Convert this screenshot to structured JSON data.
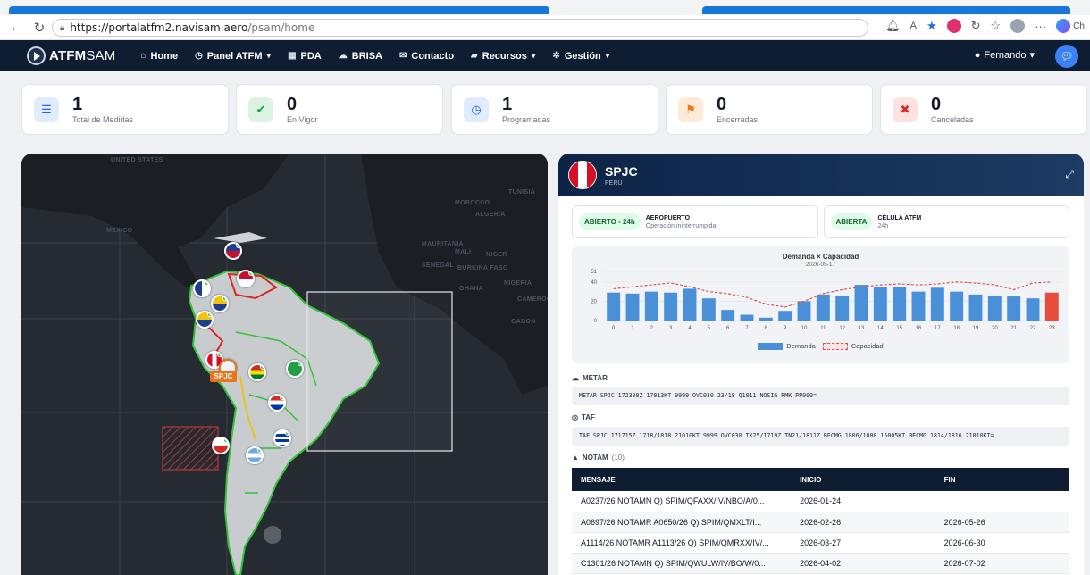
{
  "browser": {
    "url_host": "https://portalatfm2.navisam.aero",
    "url_path": "/psam/home",
    "right_label": "Ch"
  },
  "app": {
    "brand_bold": "ATFM",
    "brand_light": "SAM",
    "menu": [
      {
        "label": "Home",
        "icon": "home-icon",
        "glyph": "⌂",
        "caret": ""
      },
      {
        "label": "Panel ATFM",
        "icon": "clock-icon",
        "glyph": "◷",
        "caret": "▾"
      },
      {
        "label": "PDA",
        "icon": "table-icon",
        "glyph": "▦",
        "caret": ""
      },
      {
        "label": "BRISA",
        "icon": "cloud-icon",
        "glyph": "☁",
        "caret": ""
      },
      {
        "label": "Contacto",
        "icon": "mail-icon",
        "glyph": "✉",
        "caret": ""
      },
      {
        "label": "Recursos",
        "icon": "folder-icon",
        "glyph": "▰",
        "caret": "▾"
      },
      {
        "label": "Gestión",
        "icon": "gear-icon",
        "glyph": "✲",
        "caret": "▾"
      }
    ],
    "user": "Fernando"
  },
  "stats": [
    {
      "value": "1",
      "label": "Total de Medidas",
      "icon": "list-icon",
      "glyph": "☰",
      "bg": "#e0ecfb",
      "fg": "#2563eb"
    },
    {
      "value": "0",
      "label": "En Vigor",
      "icon": "check-circle-icon",
      "glyph": "✔",
      "bg": "#dcf3e4",
      "fg": "#16a34a"
    },
    {
      "value": "1",
      "label": "Programadas",
      "icon": "clock-icon",
      "glyph": "◷",
      "bg": "#e0ecfb",
      "fg": "#2563eb"
    },
    {
      "value": "0",
      "label": "Encerradas",
      "icon": "flag-checkered-icon",
      "glyph": "⚑",
      "bg": "#fdebd7",
      "fg": "#ea7a1a"
    },
    {
      "value": "0",
      "label": "Canceladas",
      "icon": "x-circle-icon",
      "glyph": "✖",
      "bg": "#fde2e2",
      "fg": "#dc2626"
    }
  ],
  "map": {
    "labels": [
      "UNITED STATES",
      "MEXICO",
      "ALGERIA",
      "TUNISIA",
      "MOROCCO",
      "MAURITANIA",
      "MALI",
      "NIGER",
      "SENEGAL",
      "BURKINA FASO",
      "GHANA",
      "NIGERIA",
      "CAMEROON",
      "GABON"
    ],
    "selected_tag": "SPJC"
  },
  "detail": {
    "code": "SPJC",
    "country": "PERU",
    "airport_status": "ABIERTO - 24h",
    "airport_title": "AEROPUERTO",
    "airport_sub": "Operación ininterrumpida",
    "cell_status": "ABIERTA",
    "cell_title": "CÉLULA ATFM",
    "cell_sub": "24h",
    "metar_label": "METAR",
    "metar": "METAR SPJC 172300Z 17013KT 9999 OVC030 23/18 Q1011 NOSIG RMK PP000=",
    "taf_label": "TAF",
    "taf": "TAF SPJC 171715Z 1718/1818 21010KT 9999 OVC030 TX25/1719Z TN21/1811Z BECMG 1806/1808 15005KT BECMG 1814/1816 21010KT=",
    "notam_label": "NOTAM",
    "notam_count": "(10)",
    "notam_headers": [
      "MENSAJE",
      "INICIO",
      "FIN"
    ],
    "notam_rows": [
      [
        "A0237/26 NOTAMN Q) SPIM/QFAXX/IV/NBO/A/0...",
        "2026-01-24",
        ""
      ],
      [
        "A0697/26 NOTAMR A0650/26 Q) SPIM/QMXLT/I...",
        "2026-02-26",
        "2026-05-26"
      ],
      [
        "A1114/26 NOTAMR A1113/26 Q) SPIM/QMRXX/IV/...",
        "2026-03-27",
        "2026-06-30"
      ],
      [
        "C1301/26 NOTAMN Q) SPIM/QWULW/IV/BO/W/0...",
        "2026-04-02",
        "2026-07-02"
      ]
    ]
  },
  "chart_data": {
    "type": "bar",
    "title": "Demanda × Capacidad",
    "subtitle": "2026-05-17",
    "categories": [
      "0",
      "1",
      "2",
      "3",
      "4",
      "5",
      "6",
      "7",
      "8",
      "9",
      "10",
      "11",
      "12",
      "13",
      "14",
      "15",
      "16",
      "17",
      "18",
      "19",
      "20",
      "21",
      "22",
      "23"
    ],
    "series": [
      {
        "name": "Demanda",
        "type": "bar",
        "color": "#4a90d9",
        "highlight_color": "#e74c3c",
        "highlight_index": 23,
        "values": [
          29,
          28,
          30,
          29,
          33,
          23,
          11,
          6,
          3,
          10,
          20,
          27,
          26,
          37,
          35,
          35,
          30,
          34,
          30,
          27,
          26,
          25,
          23,
          29
        ]
      },
      {
        "name": "Capacidad",
        "type": "line",
        "color": "#e05252",
        "dashed": true,
        "values": [
          33,
          35,
          37,
          39,
          35,
          30,
          28,
          24,
          17,
          14,
          20,
          28,
          32,
          35,
          37,
          38,
          37,
          38,
          40,
          39,
          37,
          32,
          39,
          40
        ]
      }
    ],
    "yticks": [
      0,
      20,
      40,
      51
    ],
    "ylim": [
      0,
      51
    ],
    "legend": "bottom"
  }
}
